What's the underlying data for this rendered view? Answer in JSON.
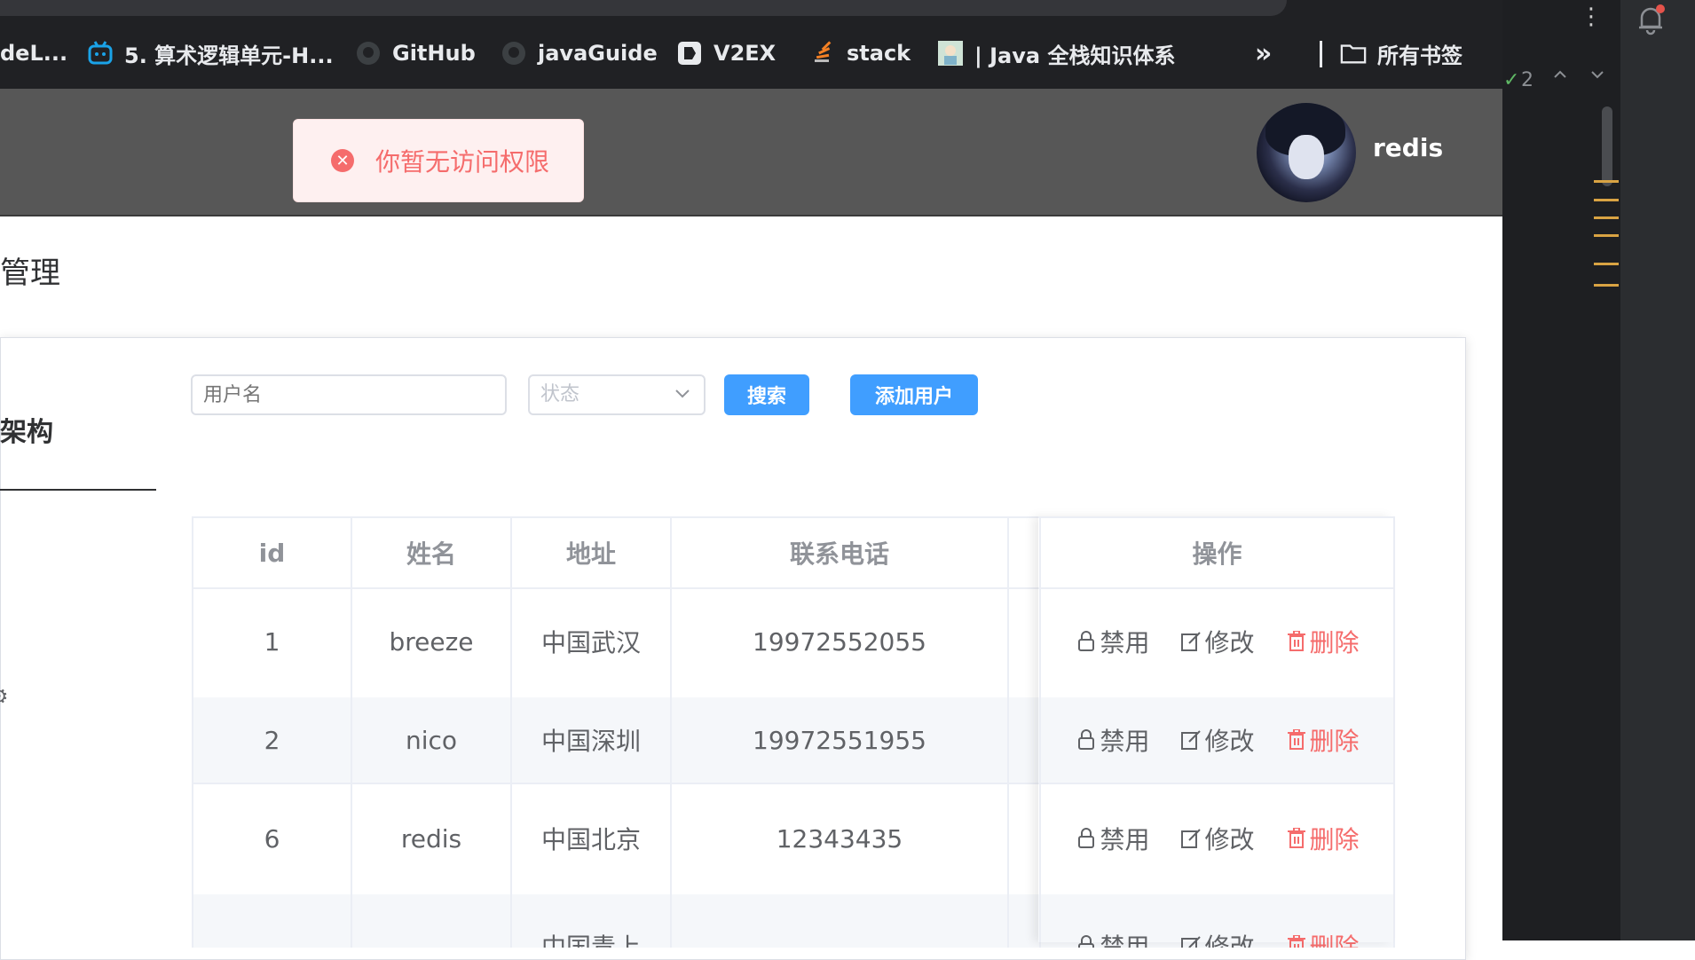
{
  "bookmarks": [
    {
      "label": "deL...",
      "icon": "none"
    },
    {
      "label": "5. 算术逻辑单元-H...",
      "icon": "bilibili-icon"
    },
    {
      "label": "GitHub",
      "icon": "github-icon"
    },
    {
      "label": "javaGuide",
      "icon": "github-icon"
    },
    {
      "label": "V2EX",
      "icon": "v2ex-icon"
    },
    {
      "label": "stack",
      "icon": "stackoverflow-icon"
    },
    {
      "label": "| Java 全栈知识体系",
      "icon": "java-icon"
    },
    {
      "label": "所有书签",
      "icon": "folder-icon"
    }
  ],
  "bookmarks_overflow": "»",
  "header": {
    "toast_message": "你暂无访问权限",
    "username": "redis"
  },
  "page": {
    "title": "管理",
    "side_title": "架构"
  },
  "filters": {
    "username_placeholder": "用户名",
    "status_placeholder": "状态",
    "search_label": "搜索",
    "add_user_label": "添加用户"
  },
  "table": {
    "headers": [
      "id",
      "姓名",
      "地址",
      "联系电话",
      "",
      "操作"
    ],
    "rows": [
      {
        "id": "1",
        "name": "breeze",
        "address": "中国武汉",
        "phone": "19972552055"
      },
      {
        "id": "2",
        "name": "nico",
        "address": "中国深圳",
        "phone": "19972551955"
      },
      {
        "id": "6",
        "name": "redis",
        "address": "中国北京",
        "phone": "12343435"
      },
      {
        "id": "",
        "name": "",
        "address": "中国青上",
        "phone": ""
      }
    ],
    "actions": {
      "disable": "禁用",
      "edit": "修改",
      "delete": "删除"
    }
  },
  "ide": {
    "count": "2"
  },
  "colors": {
    "primary": "#409eff",
    "danger": "#f56c6c",
    "header_bg": "#575757",
    "chrome_bg": "#202124"
  }
}
